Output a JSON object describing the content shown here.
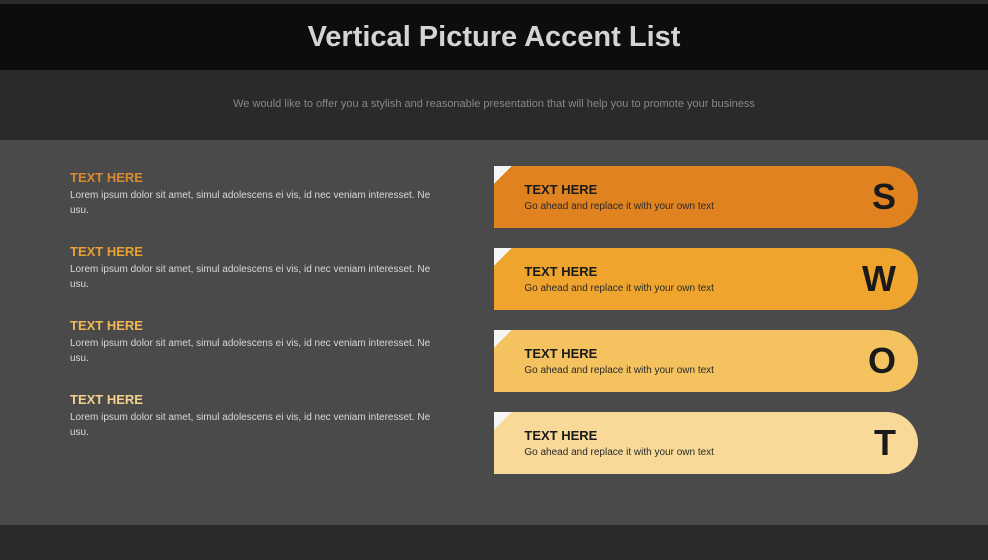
{
  "title": "Vertical Picture Accent List",
  "subtitle": "We would like to offer you a stylish and reasonable presentation that will help you to promote your business",
  "leftItems": [
    {
      "heading": "TEXT HERE",
      "body": "Lorem ipsum dolor sit amet, simul adolescens ei vis, id nec veniam interesset. Ne usu.",
      "headingColor": "#d98a2e"
    },
    {
      "heading": "TEXT HERE",
      "body": "Lorem ipsum dolor sit amet, simul adolescens ei vis, id nec veniam interesset. Ne usu.",
      "headingColor": "#eaa12d"
    },
    {
      "heading": "TEXT HERE",
      "body": "Lorem ipsum dolor sit amet, simul adolescens ei vis, id nec veniam interesset. Ne usu.",
      "headingColor": "#f0b956"
    },
    {
      "heading": "TEXT HERE",
      "body": "Lorem ipsum dolor sit amet, simul adolescens ei vis, id nec veniam interesset. Ne usu.",
      "headingColor": "#f5d18e"
    }
  ],
  "bars": [
    {
      "heading": "TEXT HERE",
      "sub": "Go ahead and replace it with your own text",
      "letter": "S",
      "color": "#e0821f"
    },
    {
      "heading": "TEXT HERE",
      "sub": "Go ahead and replace it with your own text",
      "letter": "W",
      "color": "#efa52d"
    },
    {
      "heading": "TEXT HERE",
      "sub": "Go ahead and replace it with your own text",
      "letter": "O",
      "color": "#f4c25f"
    },
    {
      "heading": "TEXT HERE",
      "sub": "Go ahead and replace it with your own text",
      "letter": "T",
      "color": "#f8d998"
    }
  ]
}
